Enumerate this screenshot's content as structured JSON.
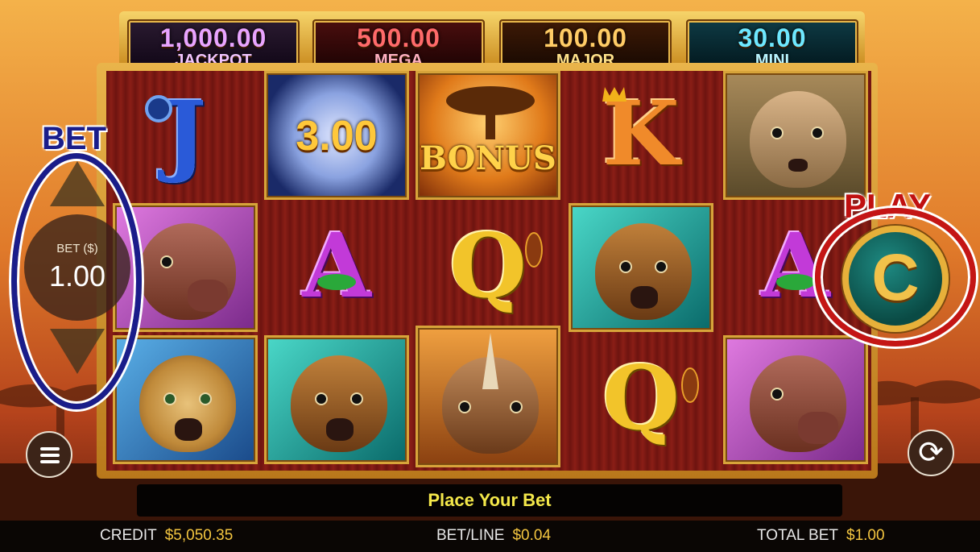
{
  "jackpots": {
    "jackpot": {
      "value": "1,000.00",
      "label": "JACKPOT"
    },
    "mega": {
      "value": "500.00",
      "label": "MEGA"
    },
    "major": {
      "value": "100.00",
      "label": "MAJOR"
    },
    "mini": {
      "value": "30.00",
      "label": "MINI"
    }
  },
  "reels": {
    "row1": {
      "j": "J",
      "moon_value": "3.00",
      "bonus": "BONUS",
      "k": "K",
      "meerkat": "meerkat"
    },
    "row2": {
      "warthog": "warthog",
      "a1": "A",
      "q1": "Q",
      "hyena1": "hyena",
      "a2": "A"
    },
    "row3": {
      "leopard": "leopard",
      "hyena2": "hyena",
      "rhino": "rhino",
      "q2": "Q",
      "warthog2": "warthog"
    }
  },
  "bet_panel": {
    "title": "BET",
    "label": "BET ($)",
    "value": "1.00"
  },
  "play_panel": {
    "title": "PLAY"
  },
  "message": "Place Your Bet",
  "status": {
    "credit_label": "CREDIT",
    "credit_value": "$5,050.35",
    "betline_label": "BET/LINE",
    "betline_value": "$0.04",
    "totalbet_label": "TOTAL BET",
    "totalbet_value": "$1.00"
  },
  "icons": [
    "menu-icon",
    "refresh-icon",
    "spin-icon",
    "arrow-up-icon",
    "arrow-down-icon"
  ]
}
